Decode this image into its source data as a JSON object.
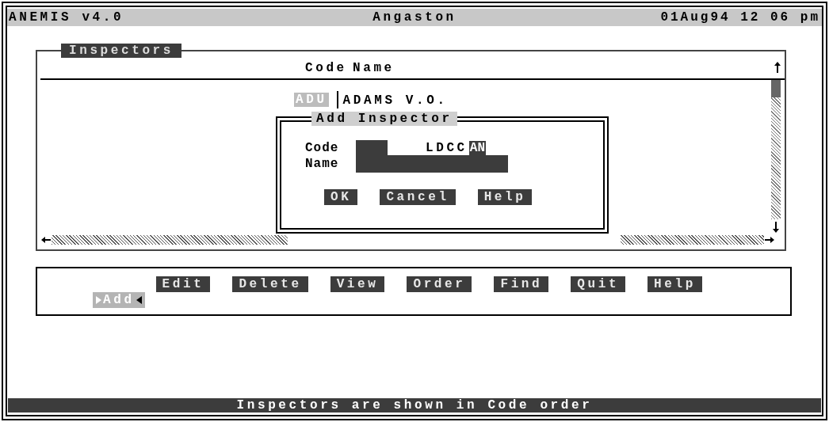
{
  "app": {
    "title": "ANEMIS v4.0",
    "location": "Angaston",
    "datetime": "01Aug94 12 06 pm"
  },
  "panel": {
    "title": "Inspectors",
    "columns": [
      "Code",
      "Name"
    ],
    "rows": [
      {
        "code": "ADU",
        "name": "ADAMS V.O.",
        "selected": true
      }
    ]
  },
  "dialog": {
    "title": "Add Inspector",
    "code_label": "Code",
    "name_label": "**N**ame",
    "region_label": "LDCC",
    "region_value": "AN",
    "buttons": [
      "OK",
      "Cancel",
      "Help"
    ]
  },
  "menu": [
    {
      "label": "Add",
      "selected": true
    },
    {
      "label": "Edit",
      "selected": false
    },
    {
      "label": "Delete",
      "selected": false
    },
    {
      "label": "View",
      "selected": false
    },
    {
      "label": "Order",
      "selected": false
    },
    {
      "label": "Find",
      "selected": false
    },
    {
      "label": "Quit",
      "selected": false
    },
    {
      "label": "Help",
      "selected": false
    }
  ],
  "status_bar": "Inspectors are shown in Code order"
}
